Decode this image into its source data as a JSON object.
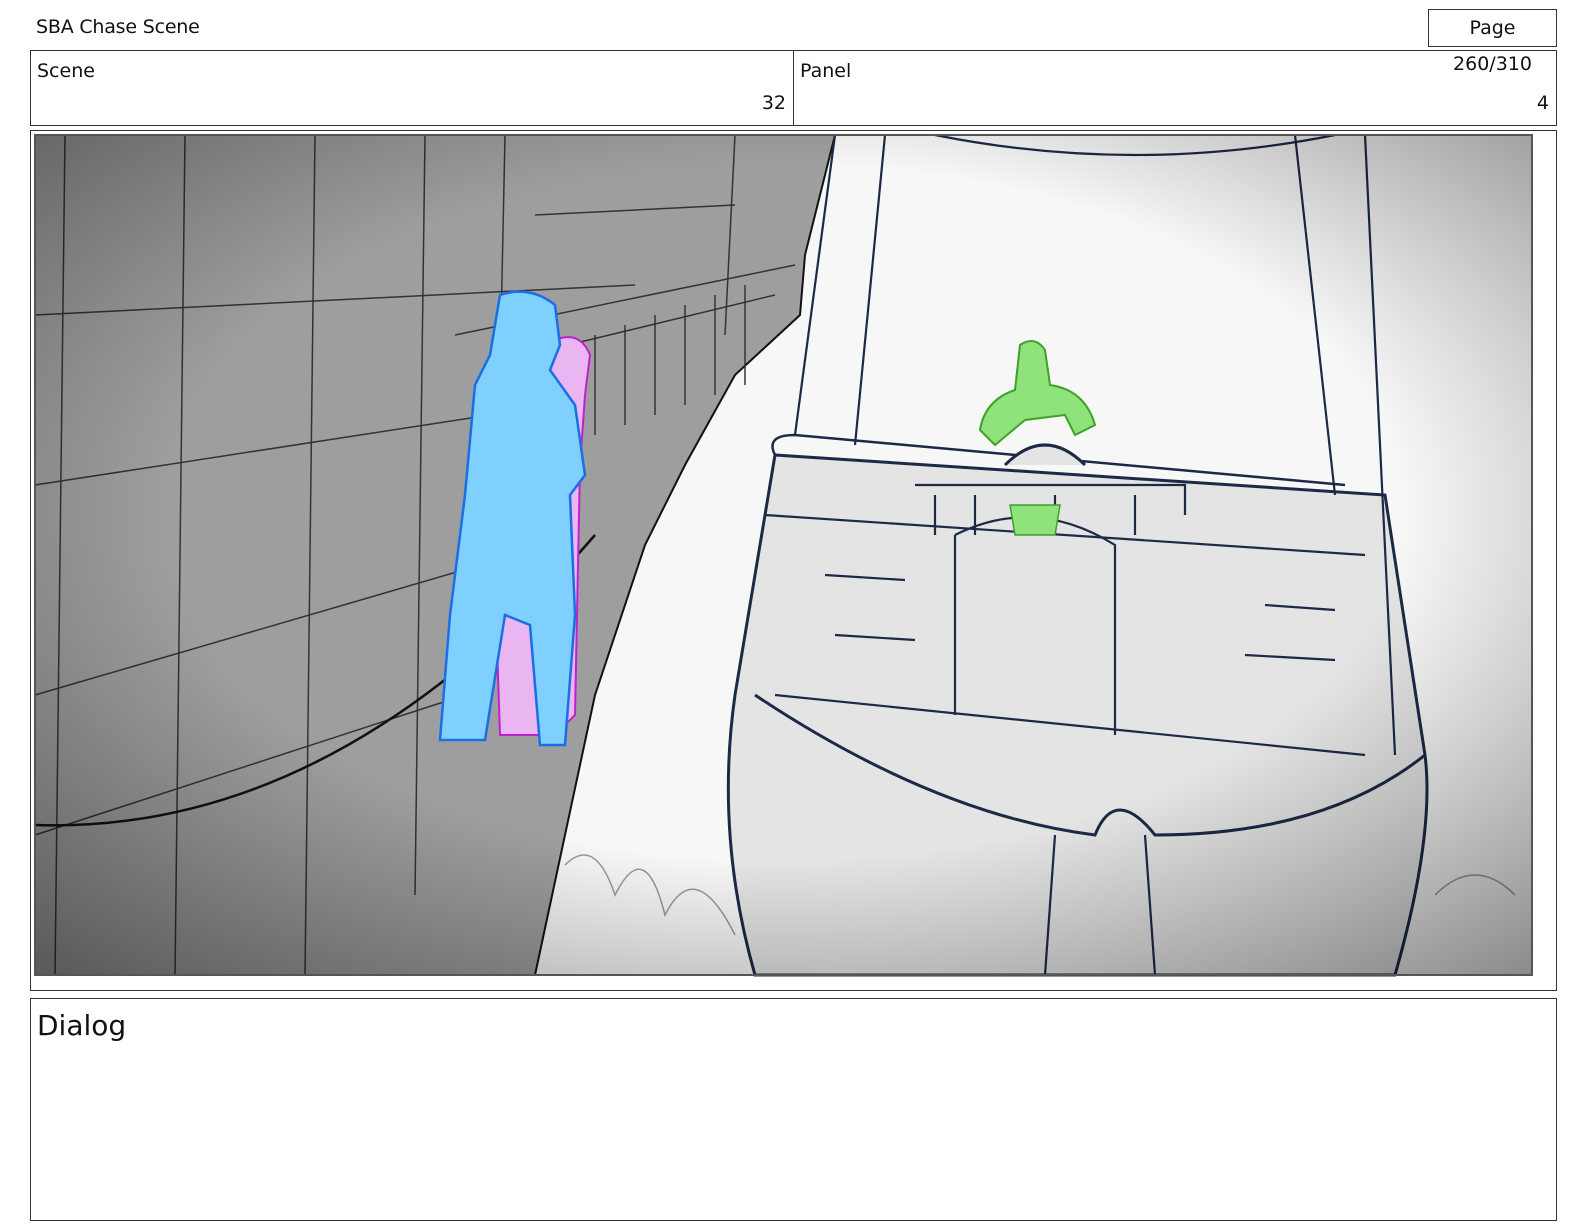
{
  "header": {
    "project_title": "SBA Chase Scene",
    "page_indicator": "Page 260/310"
  },
  "info": {
    "scene_label": "Scene",
    "scene_number": "32",
    "panel_label": "Panel",
    "panel_number": "4"
  },
  "panel": {
    "characters": [
      {
        "name": "blue-character",
        "color": "#7fd0ff"
      },
      {
        "name": "pink-character",
        "color": "#e9b6f2"
      },
      {
        "name": "green-character",
        "color": "#8fe37a"
      }
    ],
    "line_color": "#1c2947"
  },
  "dialog": {
    "label": "Dialog",
    "text": ""
  }
}
